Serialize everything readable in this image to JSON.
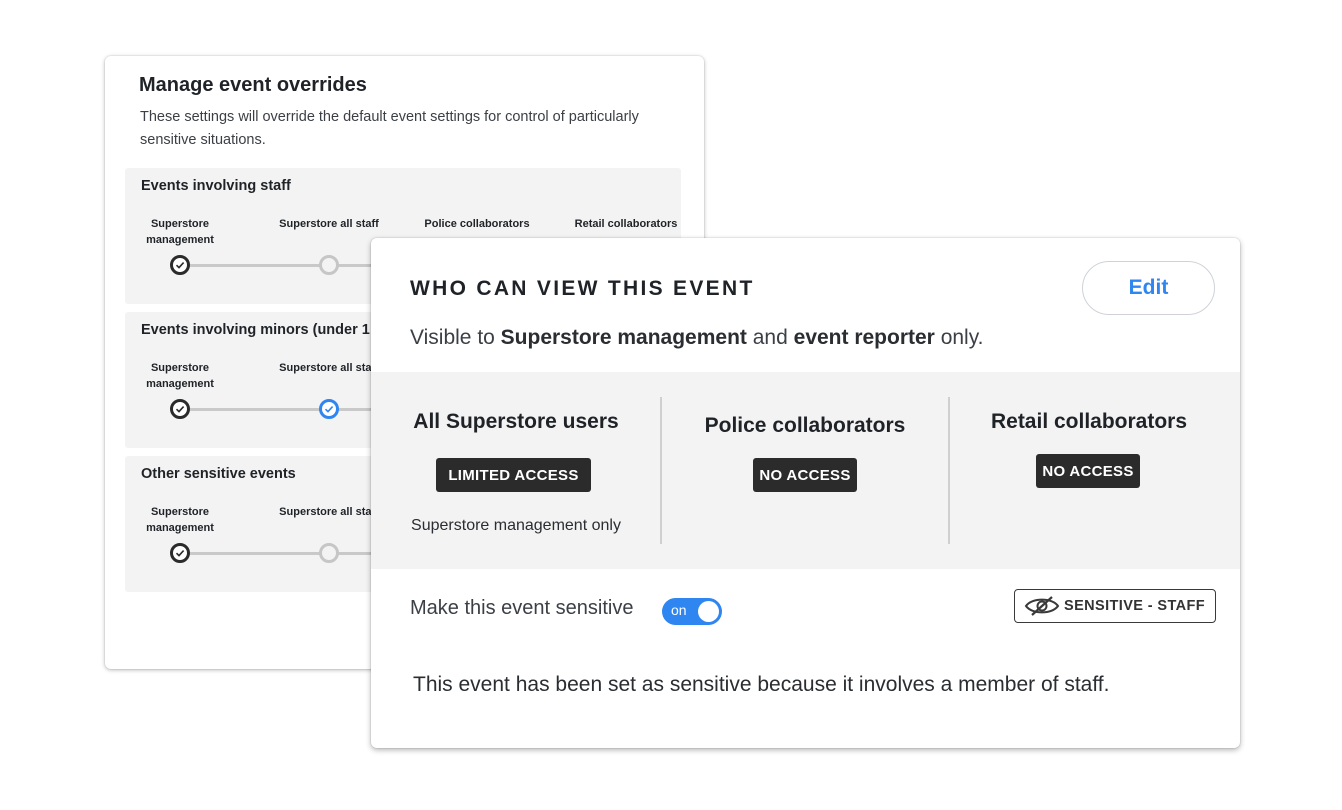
{
  "overrides": {
    "title": "Manage event overrides",
    "description": "These settings will override the default event settings for control of particularly sensitive situations.",
    "sections": [
      {
        "title": "Events involving staff",
        "columns": [
          "Superstore management",
          "Superstore all staff",
          "Police collaborators",
          "Retail collaborators"
        ]
      },
      {
        "title": "Events involving  minors (under 1",
        "columns": [
          "Superstore management",
          "Superstore all staff"
        ]
      },
      {
        "title": "Other sensitive events",
        "columns": [
          "Superstore management",
          "Superstore all staff"
        ]
      }
    ]
  },
  "viewer": {
    "title": "WHO CAN VIEW THIS EVENT",
    "edit_label": "Edit",
    "visible_prefix": "Visible to ",
    "visible_group": "Superstore management",
    "visible_and": " and ",
    "visible_reporter": "event reporter",
    "visible_suffix": " only.",
    "columns": [
      {
        "title": "All Superstore users",
        "badge": "LIMITED ACCESS",
        "note": "Superstore management only"
      },
      {
        "title": "Police collaborators",
        "badge": "NO ACCESS"
      },
      {
        "title": "Retail collaborators",
        "badge": "NO ACCESS"
      }
    ],
    "sensitive_label": "Make this event sensitive",
    "toggle_state": "on",
    "sensitive_badge": "SENSITIVE - STAFF",
    "explanation": "This event has been set as sensitive because it involves a member of staff."
  },
  "colors": {
    "accent": "#2f86f0",
    "badge_bg": "#2b2b2b",
    "panel_bg": "#f3f3f3"
  },
  "icons": [
    "check-icon",
    "eye-slash-icon"
  ]
}
